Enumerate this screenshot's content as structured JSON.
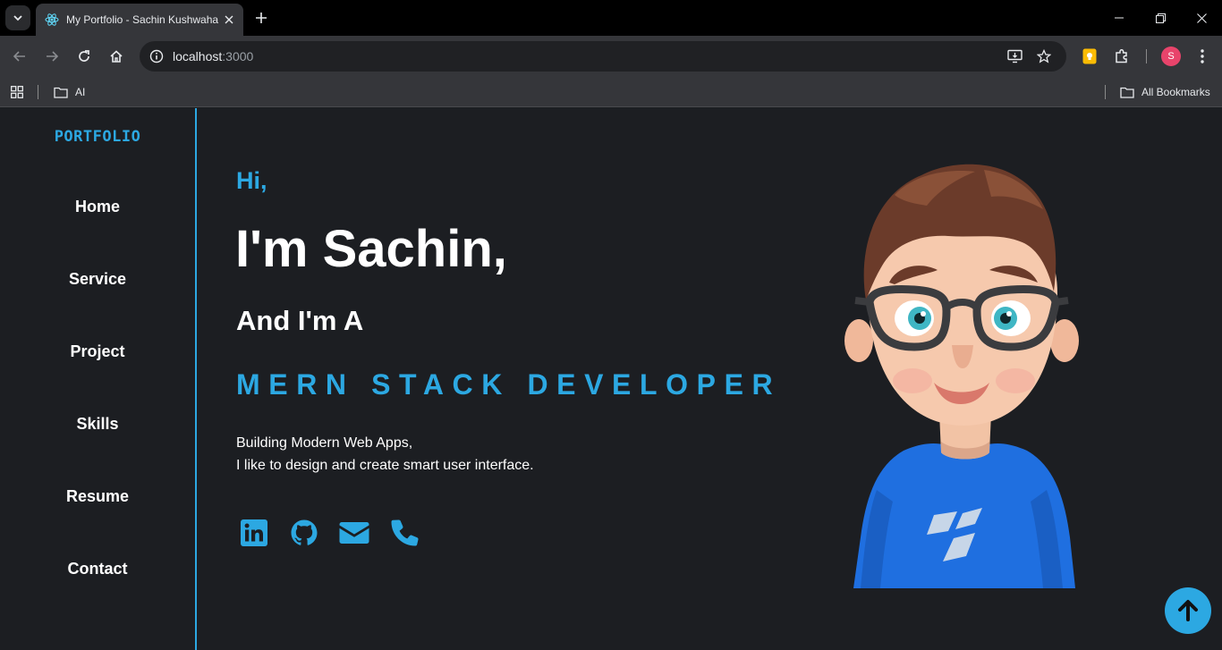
{
  "browser": {
    "tab_title": "My Portfolio - Sachin Kushwaha",
    "url_host": "localhost",
    "url_port": ":3000",
    "bookmark_folder": "AI",
    "all_bookmarks": "All Bookmarks",
    "profile_initial": "S"
  },
  "site": {
    "logo": "PORTFOLIO",
    "nav": [
      "Home",
      "Service",
      "Project",
      "Skills",
      "Resume",
      "Contact"
    ],
    "hero": {
      "greeting": "Hi,",
      "headline": "I'm Sachin,",
      "subhead": "And I'm A",
      "role": "MERN STACK DEVELOPER",
      "desc_line1": "Building Modern Web Apps,",
      "desc_line2": "I like to design and create smart user interface."
    },
    "social_icons": [
      "linkedin-icon",
      "github-icon",
      "envelope-icon",
      "phone-icon"
    ],
    "accent_color": "#2ca8e2",
    "background_color": "#1c1e22"
  }
}
